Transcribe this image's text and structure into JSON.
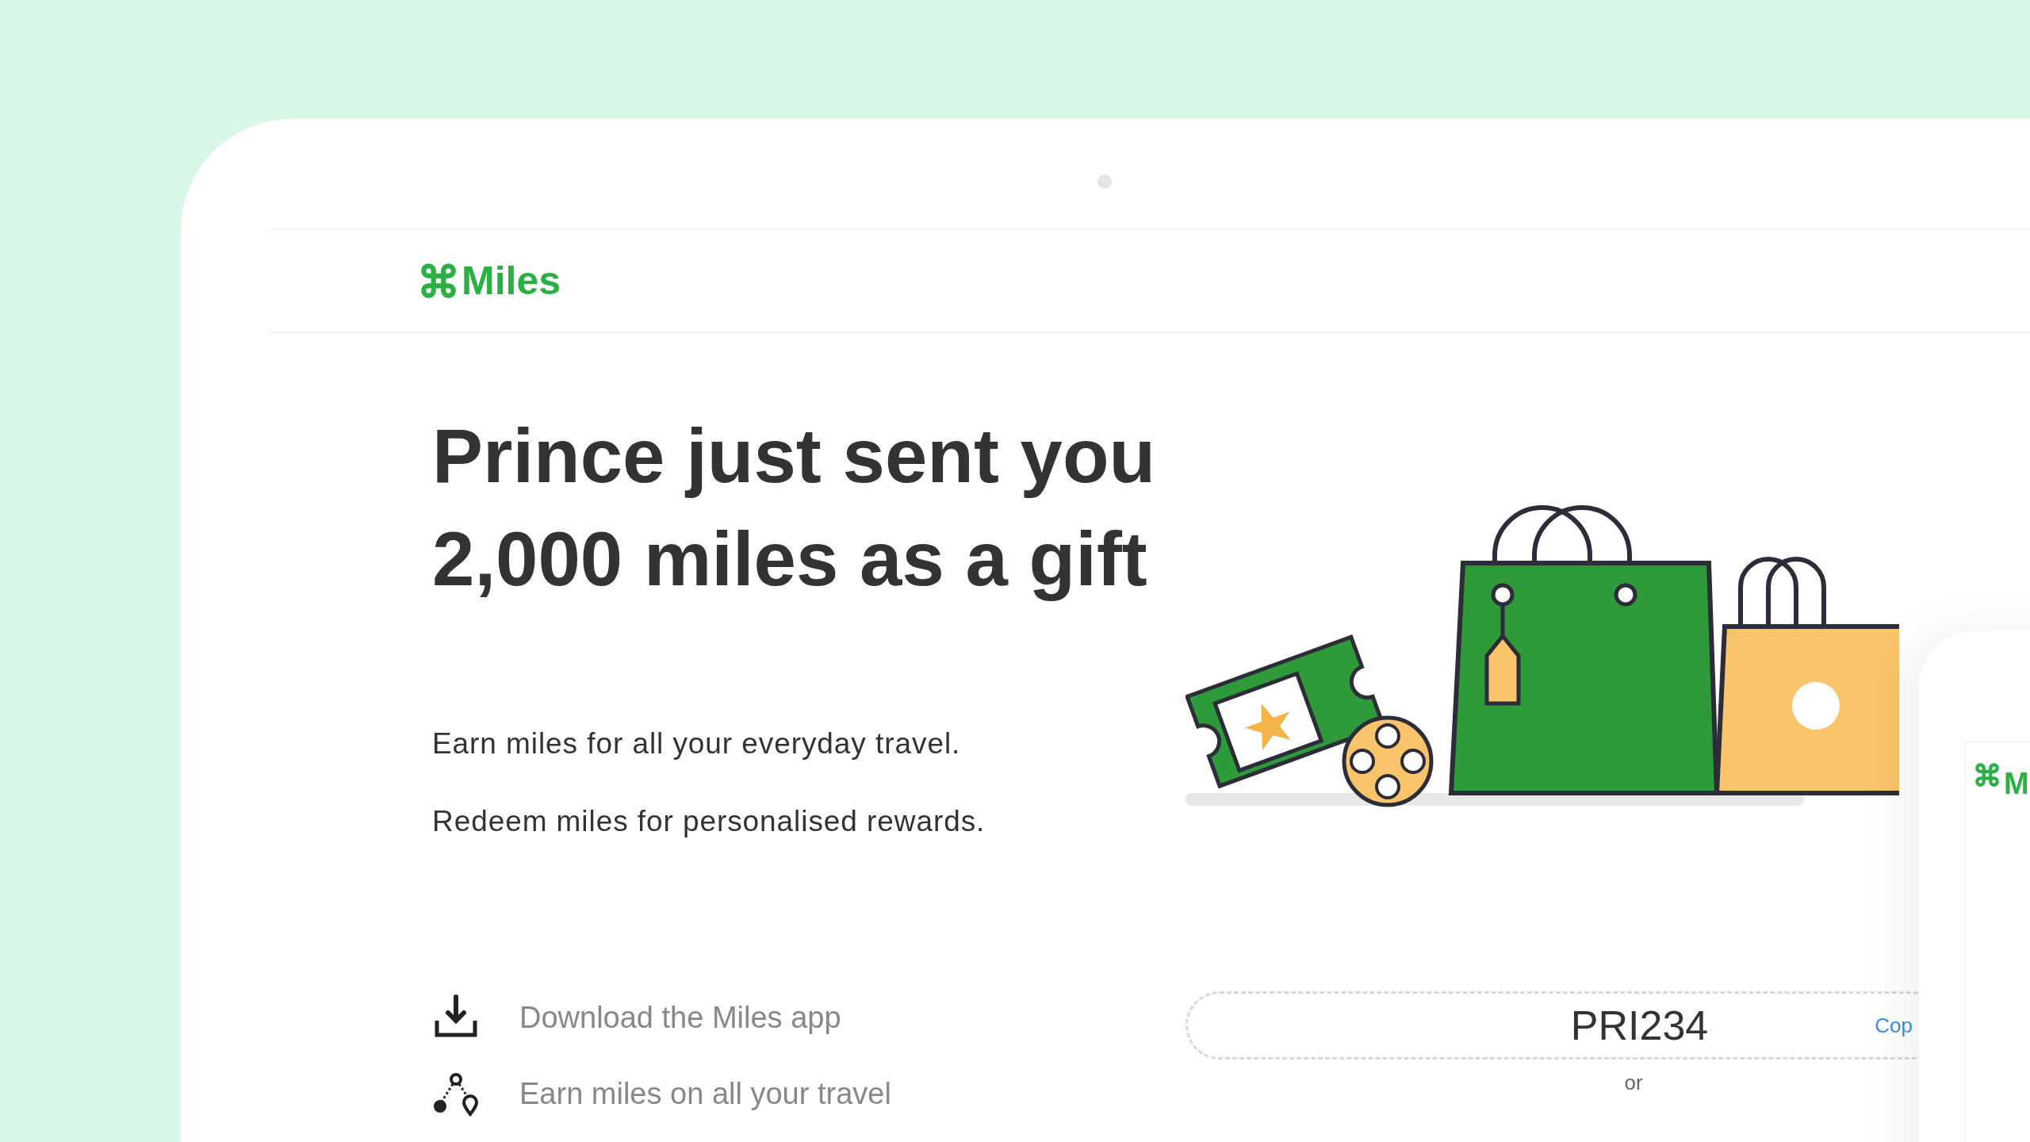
{
  "header": {
    "logo": "Miles"
  },
  "headline": [
    "Prince just sent you",
    "2,000 miles as a gift"
  ],
  "intro": [
    "Earn miles for all your everyday travel.",
    "Redeem miles for personalised rewards."
  ],
  "features": [
    {
      "kind": "download",
      "label": "Download the Miles app"
    },
    {
      "kind": "route",
      "label": "Earn miles on all your  travel"
    }
  ],
  "referral": {
    "code": "PRI234",
    "copy": "Cop",
    "separator": "or"
  },
  "phone": {
    "logo": "M"
  }
}
